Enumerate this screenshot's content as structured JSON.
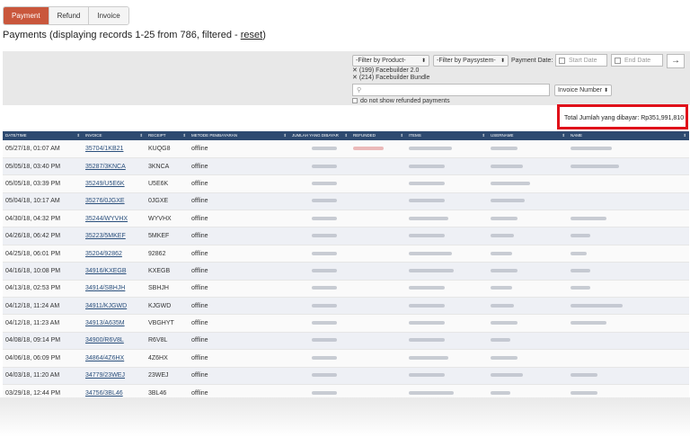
{
  "tabs": [
    "Payment",
    "Refund",
    "Invoice"
  ],
  "title": {
    "prefix": "Payments (displaying records 1-25 from 786, filtered - ",
    "reset": "reset",
    "suffix": ")"
  },
  "filters": {
    "product": "-Filter by Product-",
    "paysystem": "-Filter by Paysystem-",
    "payment_date_label": "Payment Date:",
    "start_date": "Start Date",
    "end_date": "End Date",
    "go": "→",
    "selected_products": [
      "(199) Facebuilder 2.0",
      "(214) Facebuilder Bundle"
    ],
    "search_placeholder": "",
    "search_field": "Invoice Number",
    "no_refunded": "do not show refunded payments"
  },
  "total_label": "Total Jumlah yang dibayar: Rp351,991,810",
  "columns": [
    "Date/Time",
    "Invoice",
    "Receipt",
    "Metode Pembayaran",
    "Jumlah yang dibayar",
    "Refunded",
    "Items",
    "Username",
    "Name"
  ],
  "rows": [
    [
      "05/27/18, 01:07 AM",
      "35704/1KB21",
      "KUQG8",
      "offline"
    ],
    [
      "05/05/18, 03:40 PM",
      "35287/3KNCA",
      "3KNCA",
      "offline"
    ],
    [
      "05/05/18, 03:39 PM",
      "35249/U5E6K",
      "U5E6K",
      "offline"
    ],
    [
      "05/04/18, 10:17 AM",
      "35276/0JGXE",
      "0JGXE",
      "offline"
    ],
    [
      "04/30/18, 04:32 PM",
      "35244/WYVHX",
      "WYVHX",
      "offline"
    ],
    [
      "04/26/18, 06:42 PM",
      "35223/5MKEF",
      "5MKEF",
      "offline"
    ],
    [
      "04/25/18, 06:01 PM",
      "35204/92862",
      "92862",
      "offline"
    ],
    [
      "04/16/18, 10:08 PM",
      "34916/KXEGB",
      "KXEGB",
      "offline"
    ],
    [
      "04/13/18, 02:53 PM",
      "34914/SBHJH",
      "SBHJH",
      "offline"
    ],
    [
      "04/12/18, 11:24 AM",
      "34911/KJGWD",
      "KJGWD",
      "offline"
    ],
    [
      "04/12/18, 11:23 AM",
      "34913/A635M",
      "VBGHYT",
      "offline"
    ],
    [
      "04/08/18, 09:14 PM",
      "34900/R6V8L",
      "R6V8L",
      "offline"
    ],
    [
      "04/06/18, 06:09 PM",
      "34864/4Z6HX",
      "4Z6HX",
      "offline"
    ],
    [
      "04/03/18, 11:20 AM",
      "34779/23WEJ",
      "23WEJ",
      "offline"
    ],
    [
      "03/29/18, 12:44 PM",
      "34756/3BL46",
      "3BL46",
      "offline"
    ]
  ],
  "colors": {
    "active_tab": "#c9573c",
    "header": "#2e4a70",
    "highlight": "#e0101a"
  }
}
